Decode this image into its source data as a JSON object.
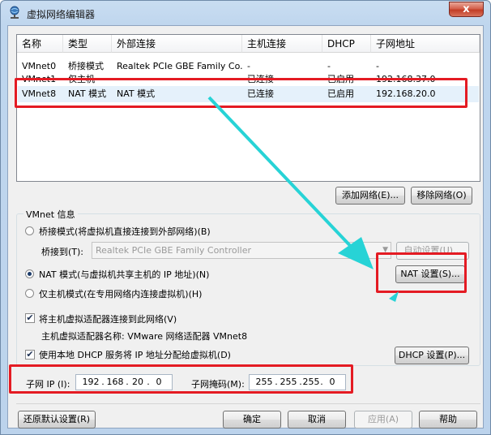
{
  "window": {
    "title": "虚拟网络编辑器",
    "close_label": "x"
  },
  "network_list": {
    "columns": [
      "名称",
      "类型",
      "外部连接",
      "主机连接",
      "DHCP",
      "子网地址"
    ],
    "rows": [
      {
        "name": "VMnet0",
        "type": "桥接模式",
        "external": "Realtek PCIe GBE Family Co...",
        "host": "-",
        "dhcp": "-",
        "subnet": "-"
      },
      {
        "name": "VMnet1",
        "type": "仅主机",
        "external": "-",
        "host": "已连接",
        "dhcp": "已启用",
        "subnet": "192.168.37.0"
      },
      {
        "name": "VMnet8",
        "type": "NAT 模式",
        "external": "NAT 模式",
        "host": "已连接",
        "dhcp": "已启用",
        "subnet": "192.168.20.0"
      }
    ],
    "selected_row": 2
  },
  "list_buttons": {
    "add": "添加网络(E)...",
    "remove": "移除网络(O)"
  },
  "vmnet_info": {
    "group_title": "VMnet 信息",
    "bridge_mode": "桥接模式(将虚拟机直接连接到外部网络)(B)",
    "bridged_to_label": "桥接到(T):",
    "bridged_to_value": "Realtek PCIe GBE Family Controller",
    "auto_settings": "自动设置(U)...",
    "nat_mode": "NAT 模式(与虚拟机共享主机的 IP 地址)(N)",
    "nat_settings": "NAT 设置(S)...",
    "host_only": "仅主机模式(在专用网络内连接虚拟机)(H)",
    "connect_adapter": "将主机虚拟适配器连接到此网络(V)",
    "adapter_name": "主机虚拟适配器名称: VMware 网络适配器 VMnet8",
    "use_dhcp": "使用本地 DHCP 服务将 IP 地址分配给虚拟机(D)",
    "dhcp_settings": "DHCP 设置(P)...",
    "selected_mode": "nat",
    "connect_adapter_checked": true,
    "use_dhcp_checked": true
  },
  "subnet": {
    "ip_label": "子网 IP (I):",
    "ip": [
      "192",
      "168",
      "20",
      "0"
    ],
    "mask_label": "子网掩码(M):",
    "mask": [
      "255",
      "255",
      "255",
      "0"
    ]
  },
  "footer": {
    "restore": "还原默认设置(R)",
    "ok": "确定",
    "cancel": "取消",
    "apply": "应用(A)",
    "help": "帮助"
  },
  "colors": {
    "highlight_box": "#e41b23",
    "arrow": "#27d3d6",
    "selected_row": "#e5f1fb"
  }
}
